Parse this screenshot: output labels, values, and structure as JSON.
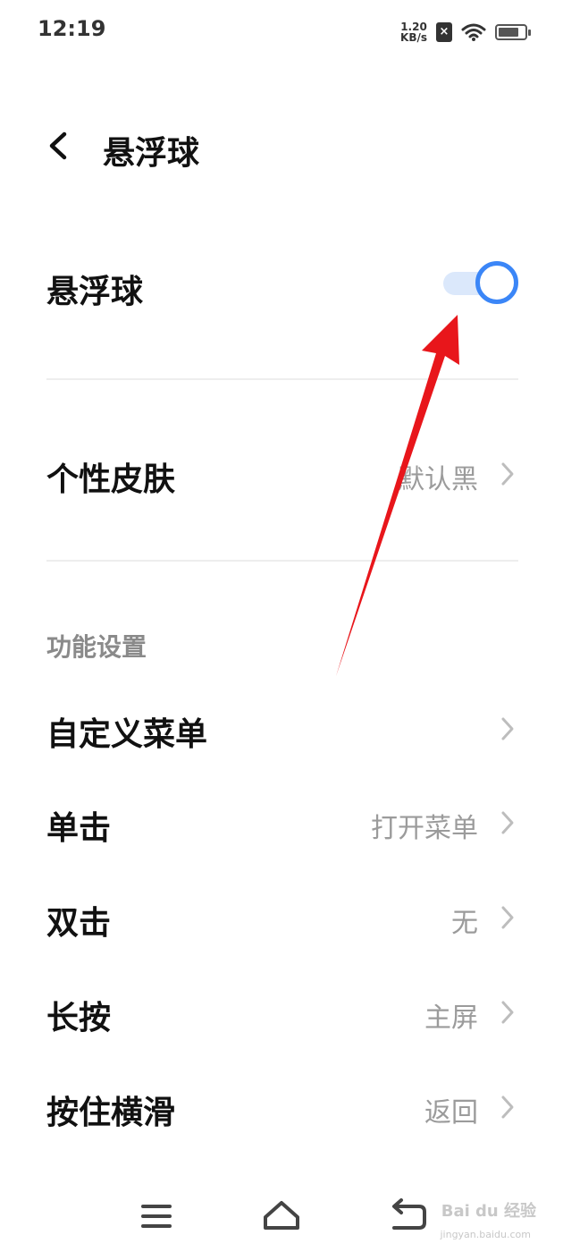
{
  "status_bar": {
    "time": "12:19",
    "net_speed_value": "1.20",
    "net_speed_unit": "KB/s",
    "sim_symbol": "×",
    "icons": [
      "sim-off-icon",
      "wifi-icon",
      "battery-icon"
    ]
  },
  "header": {
    "title": "悬浮球",
    "back_icon": "chevron-left-icon"
  },
  "toggle_row": {
    "label": "悬浮球",
    "enabled": true,
    "accent_color": "#3b86f7"
  },
  "skin_row": {
    "label": "个性皮肤",
    "value": "默认黑"
  },
  "section": {
    "title": "功能设置"
  },
  "settings": [
    {
      "label": "自定义菜单",
      "value": ""
    },
    {
      "label": "单击",
      "value": "打开菜单"
    },
    {
      "label": "双击",
      "value": "无"
    },
    {
      "label": "长按",
      "value": "主屏"
    },
    {
      "label": "按住横滑",
      "value": "返回"
    }
  ],
  "nav_bar": {
    "icons": [
      "menu-icon",
      "home-icon",
      "back-icon"
    ]
  },
  "annotation": {
    "arrow_color": "#e8161b"
  },
  "watermark": {
    "text": "Bai du 经验",
    "sub": "jingyan.baidu.com"
  }
}
